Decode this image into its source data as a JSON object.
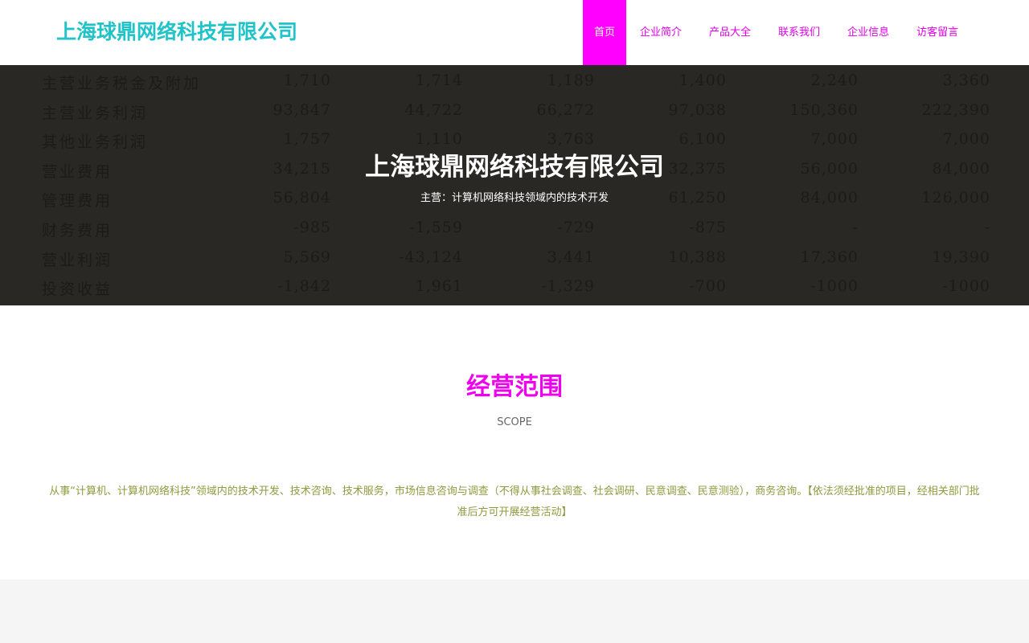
{
  "header": {
    "logo": "上海球鼎网络科技有限公司",
    "nav": [
      {
        "label": "首页",
        "active": true
      },
      {
        "label": "企业简介"
      },
      {
        "label": "产品大全"
      },
      {
        "label": "联系我们"
      },
      {
        "label": "企业信息"
      },
      {
        "label": "访客留言"
      }
    ]
  },
  "banner": {
    "title": "上海球鼎网络科技有限公司",
    "subtitle": "主营：计算机网络科技领域内的技术开发",
    "ledger_rows": [
      {
        "label": "主营业务税金及附加",
        "values": [
          "1,710",
          "1,714",
          "1,189",
          "1,400",
          "2,240",
          "3,360"
        ]
      },
      {
        "label": "主营业务利润",
        "values": [
          "93,847",
          "44,722",
          "66,272",
          "97,038",
          "150,360",
          "222,390"
        ]
      },
      {
        "label": "其他业务利润",
        "values": [
          "1,757",
          "1,110",
          "3,763",
          "6,100",
          "7,000",
          "7,000"
        ]
      },
      {
        "label": "营业费用",
        "values": [
          "34,215",
          "",
          "",
          "32,375",
          "56,000",
          "84,000"
        ]
      },
      {
        "label": "管理费用",
        "values": [
          "56,804",
          "",
          "",
          "61,250",
          "84,000",
          "126,000"
        ]
      },
      {
        "label": "财务费用",
        "values": [
          "-985",
          "-1,559",
          "-729",
          "-875",
          "-",
          "-"
        ]
      },
      {
        "label": "营业利润",
        "values": [
          "5,569",
          "-43,124",
          "3,441",
          "10,388",
          "17,360",
          "19,390"
        ]
      },
      {
        "label": "投资收益",
        "values": [
          "-1,842",
          "1,961",
          "-1,329",
          "-700",
          "-1000",
          "-1000"
        ]
      }
    ]
  },
  "scope": {
    "title": "经营范围",
    "subtitle": "SCOPE",
    "text": "从事“计算机、计算机网络科技”领域内的技术开发、技术咨询、技术服务，市场信息咨询与调查（不得从事社会调查、社会调研、民意调查、民意测验），商务咨询。【依法须经批准的项目，经相关部门批准后方可开展经营活动】"
  },
  "colors": {
    "logo": "#1fc3c8",
    "nav_text": "#e000e8",
    "nav_active_bg": "#ff00ff",
    "scope_title": "#ee00ee",
    "scope_text": "#8f9a3f",
    "banner_bg": "#2a2824"
  }
}
